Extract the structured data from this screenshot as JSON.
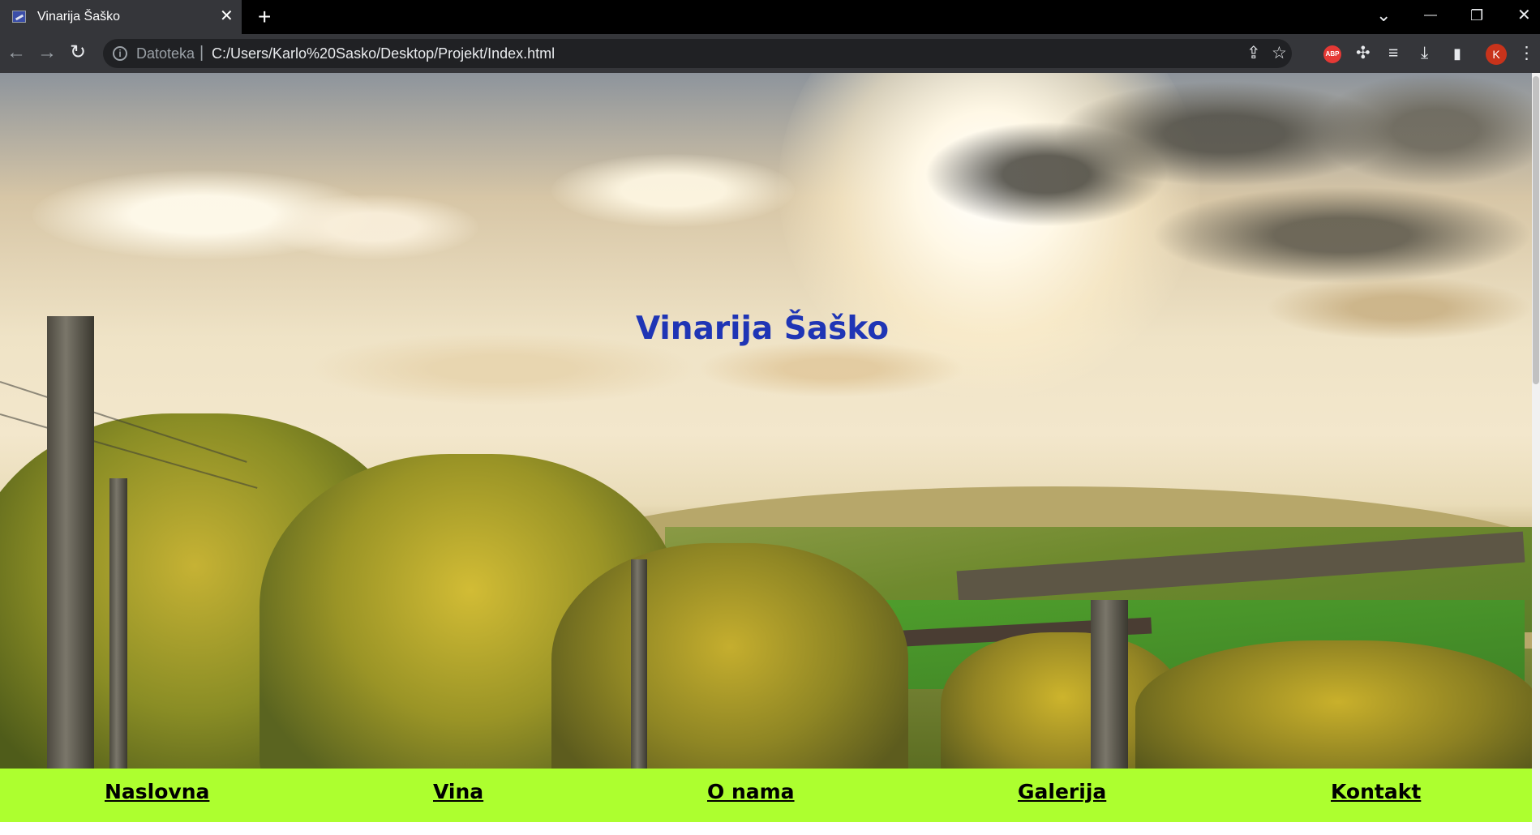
{
  "browser": {
    "tab_title": "Vinarija Šaško",
    "tab_close": "✕",
    "new_tab": "+",
    "url_scheme": "Datoteka",
    "url_separator": "|",
    "url": "C:/Users/Karlo%20Sasko/Desktop/Projekt/Index.html",
    "profile_initial": "K",
    "adblock_label": "ABP",
    "icons": {
      "back": "←",
      "forward": "→",
      "reload": "↻",
      "info": "i",
      "share": "⇪",
      "bookmark": "☆",
      "extensions": "✣",
      "reading_list": "≡",
      "download": "⤓",
      "side_panel": "▮",
      "menu": "⋮",
      "tab_search": "⌄",
      "minimize": "—",
      "restore": "❐",
      "close": "✕"
    }
  },
  "page": {
    "hero_title": "Vinarija Šaško",
    "title_color": "#1f35b5",
    "menu_background": "#adff2f",
    "menu": [
      "Naslovna",
      "Vina",
      "O nama",
      "Galerija",
      "Kontakt"
    ]
  }
}
